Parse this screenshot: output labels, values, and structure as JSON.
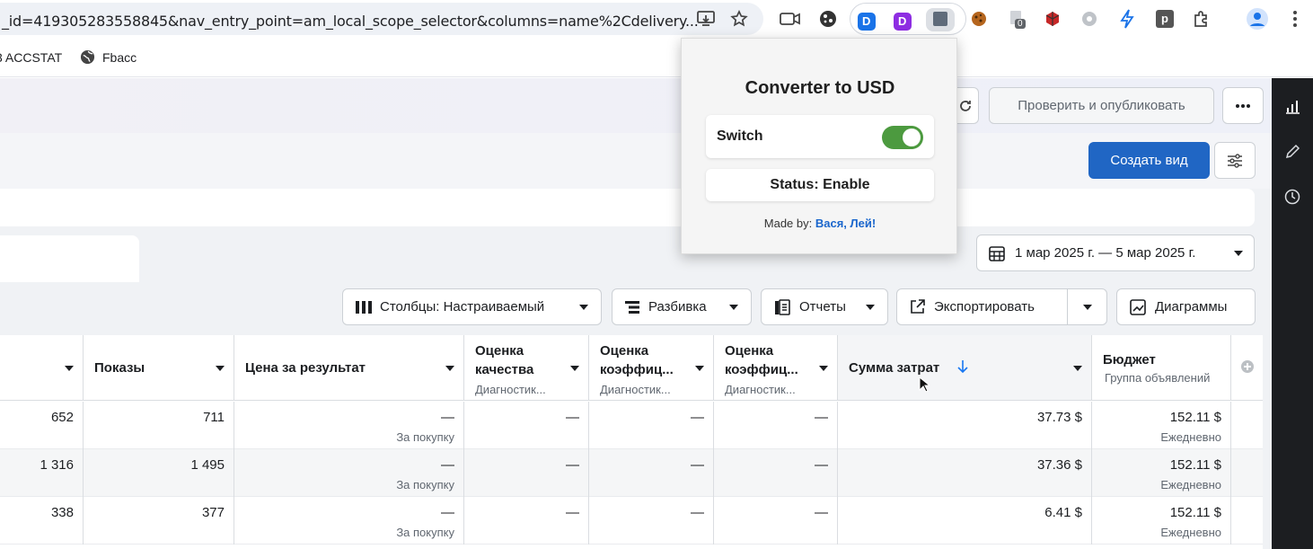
{
  "browser": {
    "url": "_id=419305283558845&nav_entry_point=am_local_scope_selector&columns=name%2Cdelivery...",
    "ext_badge_count": "0",
    "bookmarks": [
      {
        "label": "3 ACCSTAT"
      },
      {
        "label": "Fbacc"
      }
    ]
  },
  "toolbar": {
    "review_publish": "Проверить и опубликовать",
    "create_view": "Создать вид",
    "date_range": "1 мар 2025 г. — 5 мар 2025 г.",
    "columns": "Столбцы: Настраиваемый",
    "breakdown": "Разбивка",
    "reports": "Отчеты",
    "export": "Экспортировать",
    "charts": "Диаграммы"
  },
  "popup": {
    "title": "Converter to USD",
    "switch_label": "Switch",
    "switch_on": true,
    "status": "Status: Enable",
    "made_by_prefix": "Made by:",
    "made_by_names": "Вася, Лей!"
  },
  "table": {
    "headers": [
      {
        "title": "",
        "sub": ""
      },
      {
        "title": "Показы",
        "sub": ""
      },
      {
        "title": "Цена за результат",
        "sub": ""
      },
      {
        "title": "Оценка качества",
        "sub": "Диагностик..."
      },
      {
        "title": "Оценка коэффиц...",
        "sub": "Диагностик..."
      },
      {
        "title": "Оценка коэффиц...",
        "sub": "Диагностик..."
      },
      {
        "title": "Сумма затрат",
        "sub": ""
      },
      {
        "title": "Бюджет",
        "sub": "Группа объявлений"
      }
    ],
    "rows": [
      {
        "reach": "652",
        "impressions": "711",
        "cpr": "—",
        "cpr_sub": "За покупку",
        "q1": "—",
        "q2": "—",
        "q3": "—",
        "spend": "37.73 $",
        "budget": "152.11 $",
        "budget_sub": "Ежедневно"
      },
      {
        "reach": "1 316",
        "impressions": "1 495",
        "cpr": "—",
        "cpr_sub": "За покупку",
        "q1": "—",
        "q2": "—",
        "q3": "—",
        "spend": "37.36 $",
        "budget": "152.11 $",
        "budget_sub": "Ежедневно"
      },
      {
        "reach": "338",
        "impressions": "377",
        "cpr": "—",
        "cpr_sub": "За покупку",
        "q1": "—",
        "q2": "—",
        "q3": "—",
        "spend": "6.41 $",
        "budget": "152.11 $",
        "budget_sub": "Ежедневно"
      }
    ]
  },
  "colors": {
    "primary_button": "#2066c4",
    "toggle_on": "#4c9a3f",
    "sort_arrow": "#1877f2",
    "made_by_link": "#1a66cc"
  }
}
